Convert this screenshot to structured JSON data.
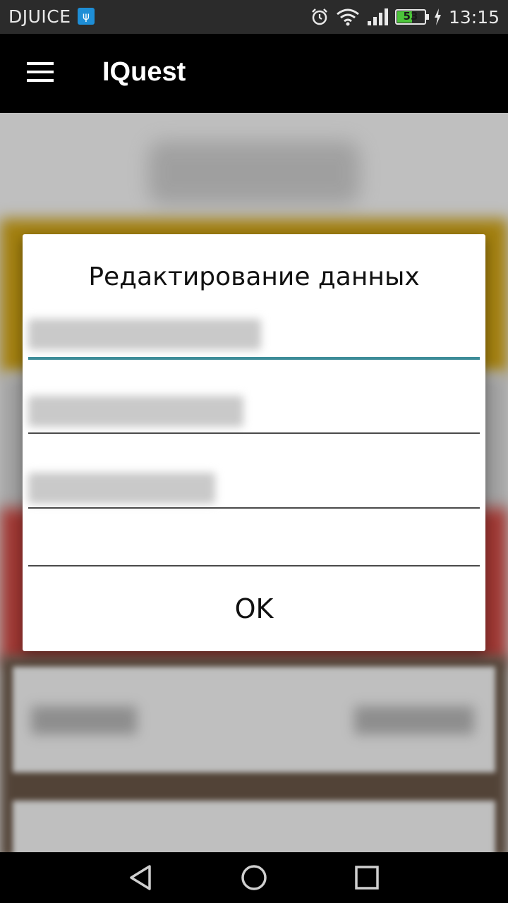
{
  "status_bar": {
    "carrier": "DJUICE",
    "usb_icon": "usb-icon",
    "icons": [
      "alarm-icon",
      "wifi-icon",
      "signal-icon",
      "battery-icon"
    ],
    "battery_level": "53",
    "time": "13:15"
  },
  "app_bar": {
    "menu_icon": "hamburger-menu-icon",
    "title": "IQuest"
  },
  "dialog": {
    "title": "Редактирование данных",
    "fields": [
      {
        "value": "",
        "note": "blurred",
        "active": true
      },
      {
        "value": "",
        "note": "blurred",
        "active": false
      },
      {
        "value": "",
        "note": "blurred",
        "active": false
      },
      {
        "value": "",
        "active": false
      }
    ],
    "ok_label": "OK"
  },
  "nav_bar": {
    "icons": [
      "back-icon",
      "home-icon",
      "recents-icon"
    ]
  },
  "colors": {
    "accent": "#3d8c98",
    "yellow_band": "#d9aa14",
    "red_band": "#d44a44",
    "battery_green": "#4cc43a",
    "usb_blue": "#1e8ed6"
  }
}
